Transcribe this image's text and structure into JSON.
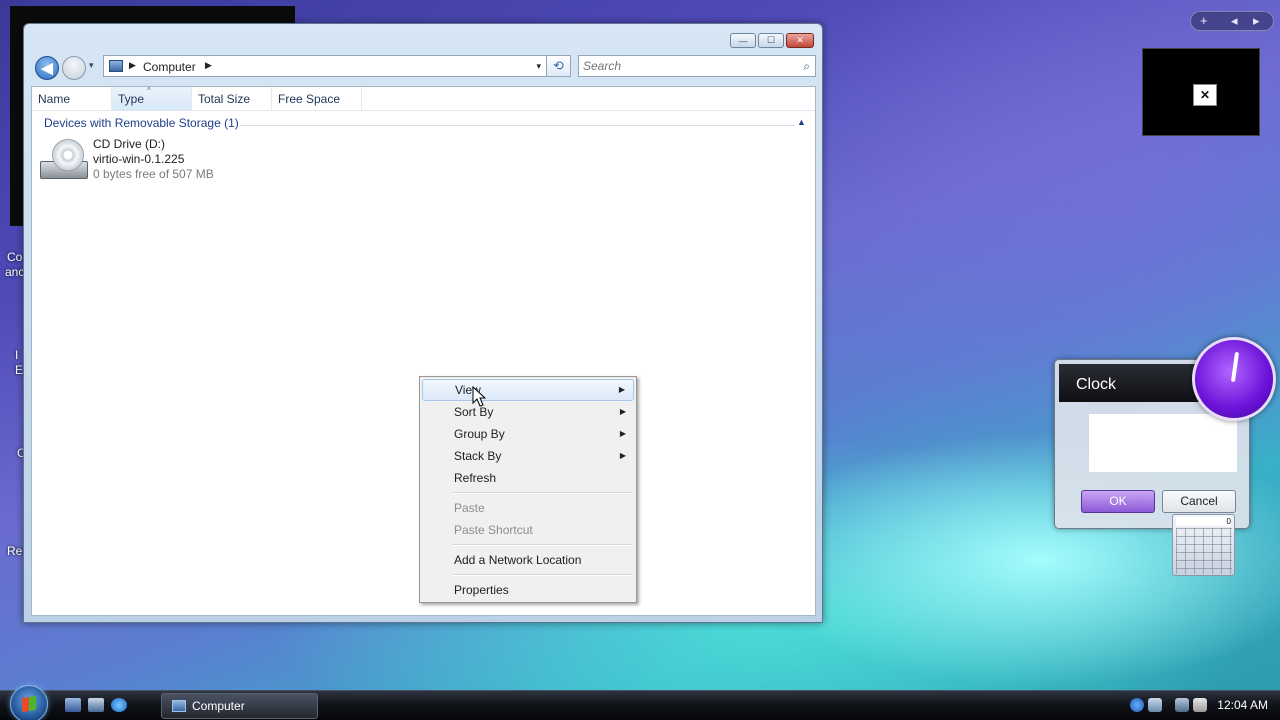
{
  "desktop": {
    "left_labels": [
      "Co",
      "anc",
      "I",
      "E",
      "C",
      "Rec"
    ]
  },
  "window": {
    "title": "Computer",
    "controls": {
      "minimize": "—",
      "maximize": "☐",
      "close": "✕"
    },
    "nav": {
      "back_icon": "◀",
      "history_icon": "▾",
      "breadcrumb": "Computer",
      "separator": "▶",
      "dropdown_icon": "▾",
      "refresh_icon": "⟲"
    },
    "search": {
      "placeholder": "Search",
      "icon": "⌕"
    },
    "columns": [
      "Name",
      "Type",
      "Total Size",
      "Free Space"
    ],
    "sort_caret": "^",
    "group": {
      "label": "Devices with Removable Storage (1)",
      "toggle_icon": "▲"
    },
    "drive": {
      "name": "CD Drive (D:)",
      "label": "virtio-win-0.1.225",
      "free": "0 bytes free of 507 MB"
    }
  },
  "context_menu": {
    "items": [
      {
        "label": "View",
        "submenu": true,
        "highlighted": true,
        "disabled": false
      },
      {
        "label": "Sort By",
        "submenu": true,
        "disabled": false
      },
      {
        "label": "Group By",
        "submenu": true,
        "disabled": false
      },
      {
        "label": "Stack By",
        "submenu": true,
        "disabled": false
      },
      {
        "label": "Refresh",
        "submenu": false,
        "disabled": false
      },
      {
        "label": "Paste",
        "submenu": false,
        "disabled": true
      },
      {
        "label": "Paste Shortcut",
        "submenu": false,
        "disabled": true
      },
      {
        "label": "Add a Network Location",
        "submenu": false,
        "disabled": false
      },
      {
        "label": "Properties",
        "submenu": false,
        "disabled": false
      }
    ],
    "arrow_icon": "▶"
  },
  "gadgets": {
    "bar": {
      "add_icon": "+",
      "prev_icon": "◂",
      "next_icon": "▸"
    },
    "thumb_close_icon": "✕",
    "clock_dialog": {
      "title": "Clock",
      "ok_label": "OK",
      "cancel_label": "Cancel"
    },
    "calculator_display": "0"
  },
  "taskbar": {
    "task_label": "Computer",
    "time": "12:04 AM"
  },
  "colors": {
    "accent": "#1e3e8c",
    "ok_button": "#8c5ad8",
    "clock_face": "#6a12d8",
    "taskbar": "#11141a"
  }
}
